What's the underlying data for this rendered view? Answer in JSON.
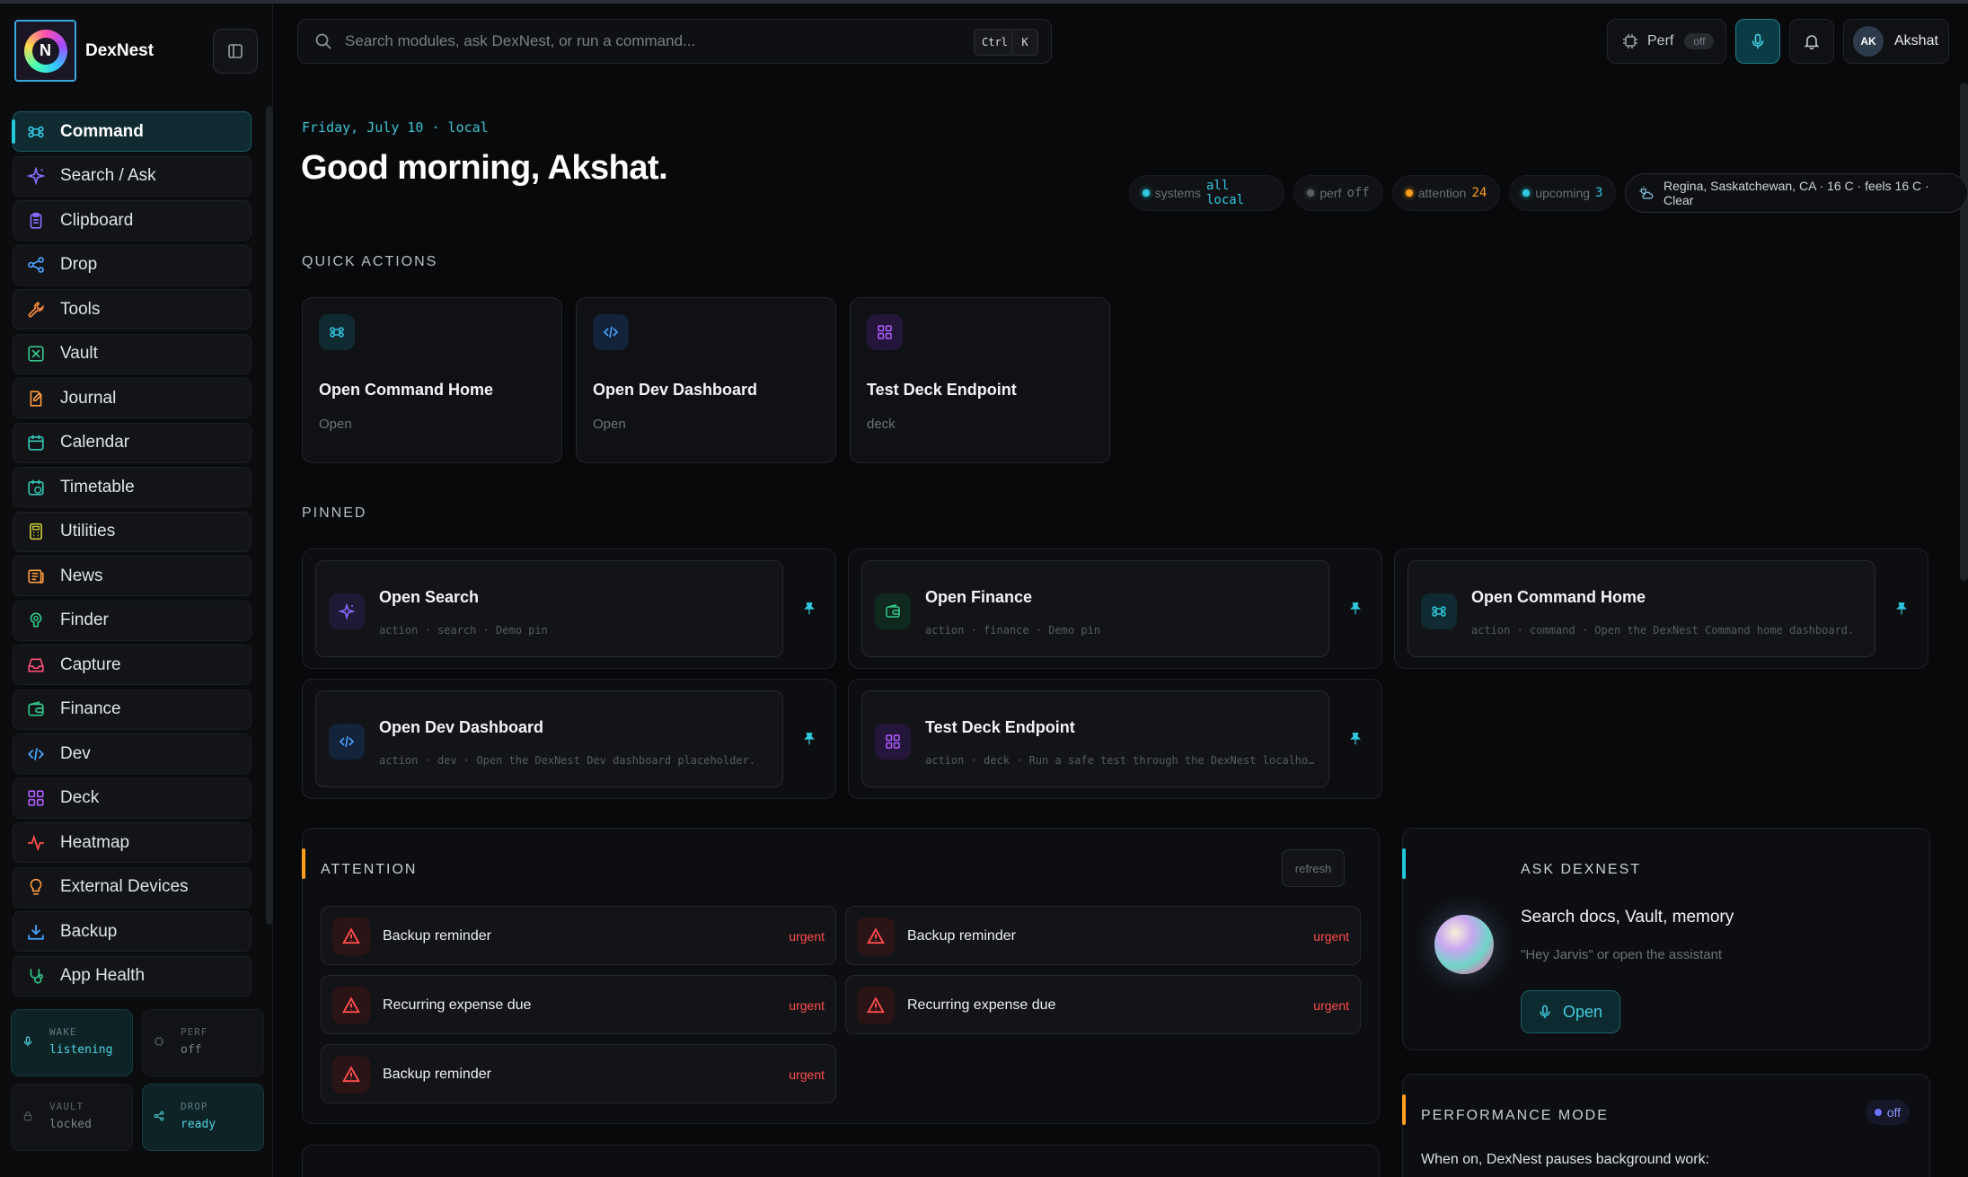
{
  "app": {
    "name": "DexNest"
  },
  "sidebar": {
    "items": [
      {
        "label": "Command",
        "icon": "command-icon",
        "color": "#31c6e0",
        "active": true
      },
      {
        "label": "Search / Ask",
        "icon": "sparkle-icon",
        "color": "#8b6cff"
      },
      {
        "label": "Clipboard",
        "icon": "clipboard-icon",
        "color": "#8b6cff"
      },
      {
        "label": "Drop",
        "icon": "share-icon",
        "color": "#4aa3ff"
      },
      {
        "label": "Tools",
        "icon": "wrench-icon",
        "color": "#ff8a3d"
      },
      {
        "label": "Vault",
        "icon": "vault-icon",
        "color": "#34c58a"
      },
      {
        "label": "Journal",
        "icon": "journal-icon",
        "color": "#ff9b3d"
      },
      {
        "label": "Calendar",
        "icon": "calendar-icon",
        "color": "#34c5b5"
      },
      {
        "label": "Timetable",
        "icon": "timetable-icon",
        "color": "#34c5b5"
      },
      {
        "label": "Utilities",
        "icon": "calculator-icon",
        "color": "#c8c83a"
      },
      {
        "label": "News",
        "icon": "news-icon",
        "color": "#ff9b3d"
      },
      {
        "label": "Finder",
        "icon": "finder-icon",
        "color": "#34c58a"
      },
      {
        "label": "Capture",
        "icon": "inbox-icon",
        "color": "#ff4d7a"
      },
      {
        "label": "Finance",
        "icon": "wallet-icon",
        "color": "#34c58a"
      },
      {
        "label": "Dev",
        "icon": "code-icon",
        "color": "#4aa3ff"
      },
      {
        "label": "Deck",
        "icon": "grid-icon",
        "color": "#b05cff"
      },
      {
        "label": "Heatmap",
        "icon": "activity-icon",
        "color": "#ff4d4d"
      },
      {
        "label": "External Devices",
        "icon": "lightbulb-icon",
        "color": "#ff9b3d"
      },
      {
        "label": "Backup",
        "icon": "download-icon",
        "color": "#4aa3ff"
      },
      {
        "label": "App Health",
        "icon": "stethoscope-icon",
        "color": "#34c58a"
      }
    ],
    "status": [
      {
        "label": "WAKE",
        "value": "listening",
        "icon": "mic-icon",
        "on": true
      },
      {
        "label": "PERF",
        "value": "off",
        "icon": "chip-icon",
        "on": false
      },
      {
        "label": "VAULT",
        "value": "locked",
        "icon": "lock-icon",
        "on": false
      },
      {
        "label": "DROP",
        "value": "ready",
        "icon": "share-icon",
        "on": true
      }
    ]
  },
  "search": {
    "placeholder": "Search modules, ask DexNest, or run a command...",
    "kbd1": "Ctrl",
    "kbd2": "K"
  },
  "topbar": {
    "perf_label": "Perf",
    "perf_state": "off",
    "user_initials": "AK",
    "user_name": "Akshat"
  },
  "header": {
    "date": "Friday, July 10 · local",
    "greeting": "Good morning, Akshat.",
    "chips": [
      {
        "label": "systems",
        "value": "all local",
        "dot": "#2fc8e0",
        "valueColor": "#2fc8e0"
      },
      {
        "label": "perf",
        "value": "off",
        "dot": "#5a5f67",
        "valueColor": "#6b7079"
      },
      {
        "label": "attention",
        "value": "24",
        "dot": "#ff9f1c",
        "valueColor": "#ff9f1c"
      },
      {
        "label": "upcoming",
        "value": "3",
        "dot": "#2fc8e0",
        "valueColor": "#2fc8e0"
      }
    ],
    "weather": "Regina, Saskatchewan, CA · 16 C · feels 16 C · Clear"
  },
  "quick_actions": {
    "label": "QUICK ACTIONS",
    "items": [
      {
        "title": "Open Command Home",
        "sub": "Open",
        "icon": "command-icon",
        "color": "#31c6e0",
        "bg": "#0f2a30"
      },
      {
        "title": "Open Dev Dashboard",
        "sub": "Open",
        "icon": "code-icon",
        "color": "#4aa3ff",
        "bg": "#13233a"
      },
      {
        "title": "Test Deck Endpoint",
        "sub": "deck",
        "icon": "grid-icon",
        "color": "#b05cff",
        "bg": "#24163a"
      }
    ]
  },
  "pinned": {
    "label": "PINNED",
    "items": [
      {
        "title": "Open Search",
        "sub": "action · search · Demo pin",
        "icon": "sparkle-icon",
        "color": "#8b6cff",
        "bg": "#1d1a36"
      },
      {
        "title": "Open Finance",
        "sub": "action · finance · Demo pin",
        "icon": "wallet-icon",
        "color": "#34c58a",
        "bg": "#10291f"
      },
      {
        "title": "Open Command Home",
        "sub": "action · command · Open the DexNest Command home dashboard.",
        "icon": "command-icon",
        "color": "#31c6e0",
        "bg": "#0f2a30"
      },
      {
        "title": "Open Dev Dashboard",
        "sub": "action · dev · Open the DexNest Dev dashboard placeholder.",
        "icon": "code-icon",
        "color": "#4aa3ff",
        "bg": "#13233a"
      },
      {
        "title": "Test Deck Endpoint",
        "sub": "action · deck · Run a safe test through the DexNest localhost endpoint",
        "icon": "grid-icon",
        "color": "#b05cff",
        "bg": "#24163a"
      }
    ]
  },
  "attention": {
    "title": "ATTENTION",
    "refresh": "refresh",
    "items": [
      {
        "title": "Backup reminder",
        "badge": "urgent"
      },
      {
        "title": "Backup reminder",
        "badge": "urgent"
      },
      {
        "title": "Recurring expense due",
        "badge": "urgent"
      },
      {
        "title": "Recurring expense due",
        "badge": "urgent"
      },
      {
        "title": "Backup reminder",
        "badge": "urgent"
      }
    ]
  },
  "ask": {
    "title": "ASK DEXNEST",
    "question": "Search docs, Vault, memory",
    "hint": "\"Hey Jarvis\" or open the assistant",
    "open_label": "Open"
  },
  "performance": {
    "title": "PERFORMANCE MODE",
    "state": "off",
    "desc": "When on, DexNest pauses background work:"
  }
}
